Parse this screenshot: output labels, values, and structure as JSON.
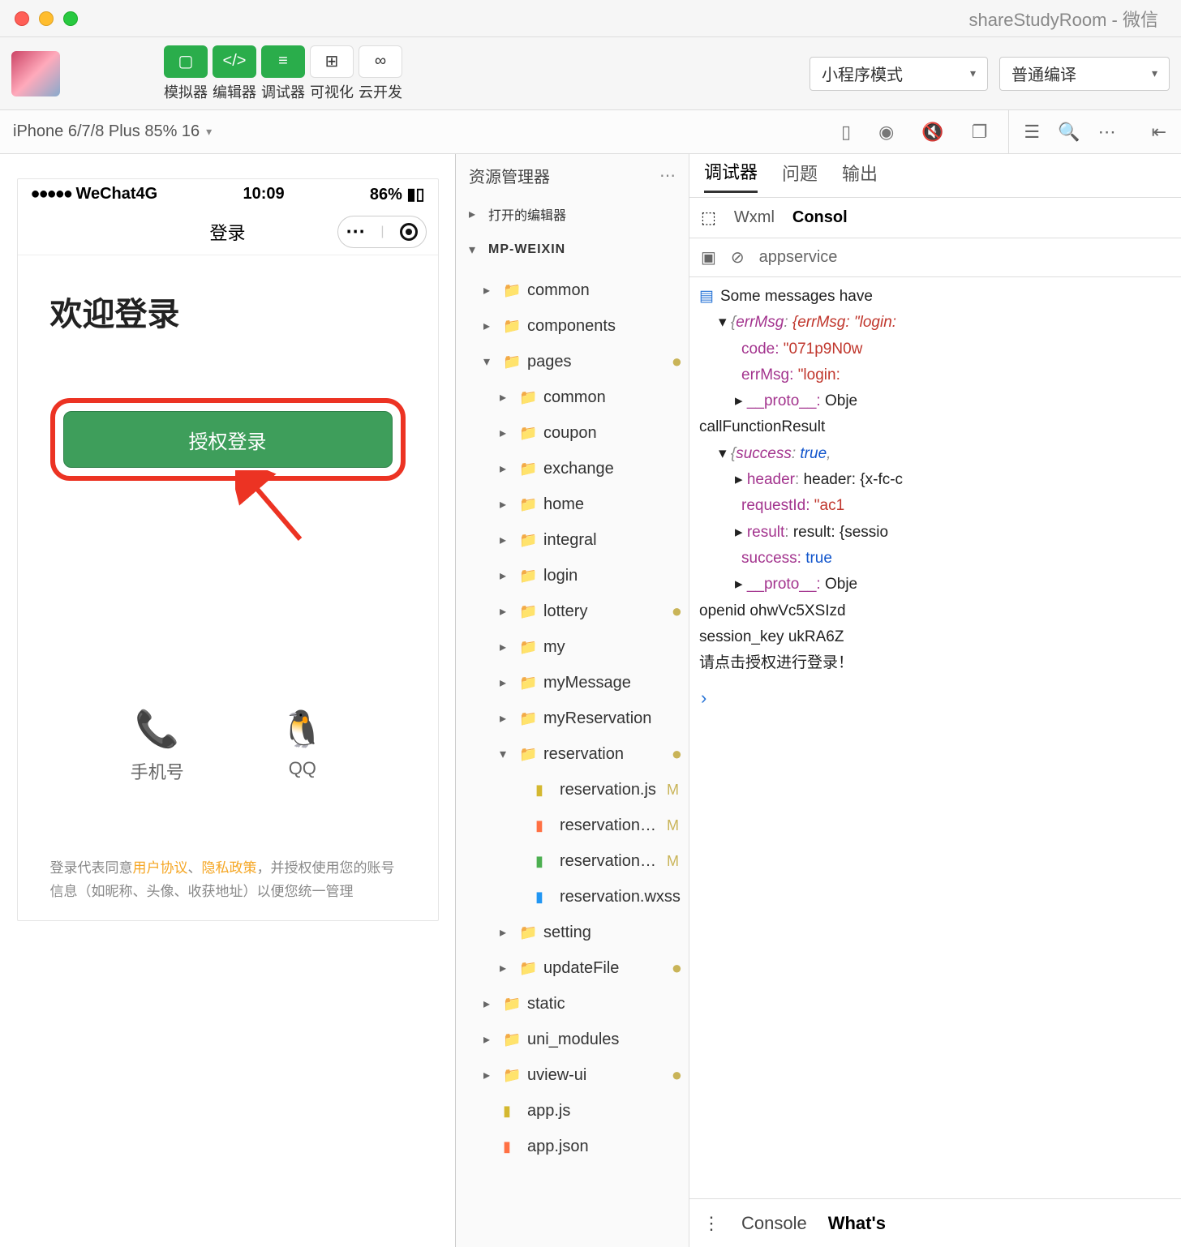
{
  "window": {
    "title": "shareStudyRoom - 微信"
  },
  "toolbar": {
    "buttons": [
      {
        "label": "模拟器",
        "icon": "▢"
      },
      {
        "label": "编辑器",
        "icon": "</>"
      },
      {
        "label": "调试器",
        "icon": "≡"
      },
      {
        "label": "可视化",
        "icon": "⊞"
      },
      {
        "label": "云开发",
        "icon": "∞"
      }
    ],
    "mode_dropdown": "小程序模式",
    "compile_dropdown": "普通编译"
  },
  "device_bar": {
    "selector": "iPhone 6/7/8 Plus 85% 16"
  },
  "phone": {
    "signal": "●●●●●",
    "carrier": "WeChat4G",
    "time": "10:09",
    "battery": "86%",
    "nav_title": "登录",
    "welcome": "欢迎登录",
    "auth_button": "授权登录",
    "login_options": [
      {
        "name": "phone",
        "label": "手机号",
        "color": "#3fbd4a"
      },
      {
        "name": "qq",
        "label": "QQ",
        "color": "#2aa3ef"
      }
    ],
    "disclaimer_prefix": "登录代表同意",
    "disclaimer_link1": "用户协议",
    "disclaimer_sep": "、",
    "disclaimer_link2": "隐私政策",
    "disclaimer_suffix": "，并授权使用您的账号信息（如昵称、头像、收获地址）以便您统一管理"
  },
  "explorer": {
    "title": "资源管理器",
    "open_editors": "打开的编辑器",
    "root": "MP-WEIXIN",
    "tree": [
      {
        "name": "common",
        "type": "folder",
        "indent": 1,
        "color": "brown",
        "chev": "▸",
        "status": ""
      },
      {
        "name": "components",
        "type": "folder",
        "indent": 1,
        "color": "yel",
        "chev": "▸",
        "status": ""
      },
      {
        "name": "pages",
        "type": "folder",
        "indent": 1,
        "color": "orange",
        "chev": "▾",
        "status": "dot"
      },
      {
        "name": "common",
        "type": "folder",
        "indent": 2,
        "color": "grey",
        "chev": "▸",
        "status": ""
      },
      {
        "name": "coupon",
        "type": "folder",
        "indent": 2,
        "color": "grey",
        "chev": "▸",
        "status": ""
      },
      {
        "name": "exchange",
        "type": "folder",
        "indent": 2,
        "color": "grey",
        "chev": "▸",
        "status": ""
      },
      {
        "name": "home",
        "type": "folder",
        "indent": 2,
        "color": "grey",
        "chev": "▸",
        "status": ""
      },
      {
        "name": "integral",
        "type": "folder",
        "indent": 2,
        "color": "grey",
        "chev": "▸",
        "status": ""
      },
      {
        "name": "login",
        "type": "folder",
        "indent": 2,
        "color": "grey",
        "chev": "▸",
        "status": ""
      },
      {
        "name": "lottery",
        "type": "folder",
        "indent": 2,
        "color": "grey",
        "chev": "▸",
        "status": "dot"
      },
      {
        "name": "my",
        "type": "folder",
        "indent": 2,
        "color": "grey",
        "chev": "▸",
        "status": ""
      },
      {
        "name": "myMessage",
        "type": "folder",
        "indent": 2,
        "color": "grey",
        "chev": "▸",
        "status": ""
      },
      {
        "name": "myReservation",
        "type": "folder",
        "indent": 2,
        "color": "grey",
        "chev": "▸",
        "status": ""
      },
      {
        "name": "reservation",
        "type": "folder",
        "indent": 2,
        "color": "teal",
        "chev": "▾",
        "status": "dot"
      },
      {
        "name": "reservation.js",
        "type": "file",
        "indent": 3,
        "color": "yel",
        "chev": "",
        "status": "M"
      },
      {
        "name": "reservation.js…",
        "type": "file",
        "indent": 3,
        "color": "orange",
        "chev": "",
        "status": "M"
      },
      {
        "name": "reservation.w…",
        "type": "file",
        "indent": 3,
        "color": "green",
        "chev": "",
        "status": "M"
      },
      {
        "name": "reservation.wxss",
        "type": "file",
        "indent": 3,
        "color": "blue",
        "chev": "",
        "status": ""
      },
      {
        "name": "setting",
        "type": "folder",
        "indent": 2,
        "color": "grey",
        "chev": "▸",
        "status": ""
      },
      {
        "name": "updateFile",
        "type": "folder",
        "indent": 2,
        "color": "grey",
        "chev": "▸",
        "status": "dot"
      },
      {
        "name": "static",
        "type": "folder",
        "indent": 1,
        "color": "brown",
        "chev": "▸",
        "status": ""
      },
      {
        "name": "uni_modules",
        "type": "folder",
        "indent": 1,
        "color": "brown",
        "chev": "▸",
        "status": ""
      },
      {
        "name": "uview-ui",
        "type": "folder",
        "indent": 1,
        "color": "brown",
        "chev": "▸",
        "status": "dot"
      },
      {
        "name": "app.js",
        "type": "file",
        "indent": 1,
        "color": "yel",
        "chev": "",
        "status": ""
      },
      {
        "name": "app.json",
        "type": "file",
        "indent": 1,
        "color": "orange",
        "chev": "",
        "status": ""
      }
    ]
  },
  "debugger": {
    "main_tabs": [
      "调试器",
      "问题",
      "输出"
    ],
    "sub_tabs": [
      "Wxml",
      "Consol"
    ],
    "service": "appservice",
    "console": {
      "hidden_msg": "Some messages have",
      "obj1": {
        "open": "{errMsg: \"login:",
        "code_k": "code:",
        "code_v": "\"071p9N0w",
        "errmsg_k": "errMsg:",
        "errmsg_v": "\"login:",
        "proto": "__proto__:",
        "proto_v": "Obje"
      },
      "call_result": "callFunctionResult",
      "obj2": {
        "open": "{success: true,",
        "header": "header: {x-fc-c",
        "reqid_k": "requestId:",
        "reqid_v": "\"ac1",
        "result": "result: {sessio",
        "success_k": "success:",
        "success_v": "true",
        "proto": "__proto__:",
        "proto_v": "Obje"
      },
      "openid": "openid ohwVc5XSIzd",
      "session": "session_key ukRA6Z",
      "tip": "请点击授权进行登录！"
    },
    "footer_tabs": [
      "Console",
      "What's"
    ]
  }
}
